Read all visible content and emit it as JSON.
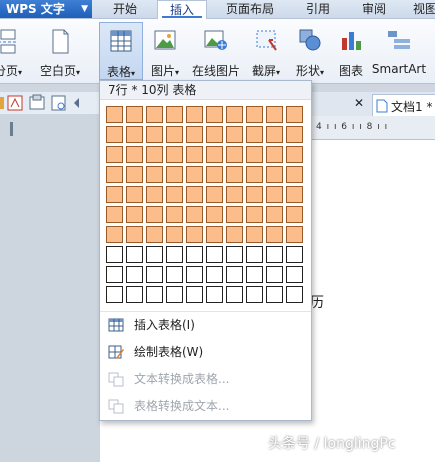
{
  "app": {
    "title": "WPS 文字",
    "menu_arrow": "▼"
  },
  "tabs": [
    {
      "label": "开始"
    },
    {
      "label": "插入"
    },
    {
      "label": "页面布局"
    },
    {
      "label": "引用"
    },
    {
      "label": "审阅"
    },
    {
      "label": "视图"
    }
  ],
  "ribbon": {
    "page_break": "分页",
    "blank_page": "空白页",
    "table": "表格",
    "picture": "图片",
    "online_picture": "在线图片",
    "screenshot": "截屏",
    "shapes": "形状",
    "chart": "图表",
    "smartart": "SmartArt",
    "dropdown_arrow": "▾"
  },
  "doc_tab": {
    "close": "✕",
    "name": "文档1 *"
  },
  "ruler": {
    "marks": "4 ı ı 6 ı ı 8 ı ı"
  },
  "document": {
    "visible_text": "历"
  },
  "table_menu": {
    "header": "7行 * 10列 表格",
    "grid": {
      "rows": 10,
      "cols": 10,
      "selected_rows": 7,
      "selected_cols": 10
    },
    "items": [
      {
        "label": "插入表格(I)",
        "enabled": true
      },
      {
        "label": "绘制表格(W)",
        "enabled": true
      },
      {
        "label": "文本转换成表格...",
        "enabled": false
      },
      {
        "label": "表格转换成文本...",
        "enabled": false
      }
    ]
  },
  "watermark": "头条号 / longlingPc",
  "colors": {
    "selected_cell": "#fbbd8a",
    "accent": "#3b7bd6"
  }
}
